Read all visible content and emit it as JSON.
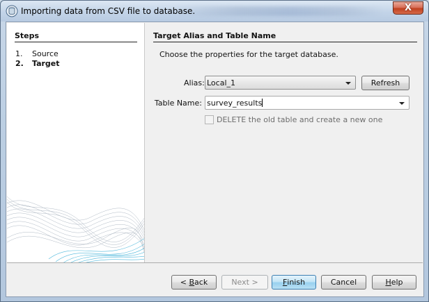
{
  "window": {
    "title": "Importing data from CSV file to database.",
    "close_glyph": "X"
  },
  "steps": {
    "title": "Steps",
    "items": [
      {
        "num": "1.",
        "label": "Source"
      },
      {
        "num": "2.",
        "label": "Target"
      }
    ]
  },
  "main": {
    "title": "Target Alias and Table Name",
    "description": "Choose the properties for the target database.",
    "alias_label": "Alias:",
    "alias_value": "Local_1",
    "refresh_label": "Refresh",
    "table_label": "Table Name:",
    "table_value": "survey_results",
    "delete_option_label": "DELETE the old table and create a new one",
    "delete_option_checked": false
  },
  "buttons": {
    "back": {
      "prefix": "< ",
      "accel": "B",
      "rest": "ack"
    },
    "next": "Next >",
    "finish": {
      "accel": "F",
      "rest": "inish"
    },
    "cancel": "Cancel",
    "help": {
      "accel": "H",
      "rest": "elp"
    }
  },
  "colors": {
    "accent_wave": "#3ab0d8",
    "default_button": "#98d1ef"
  }
}
